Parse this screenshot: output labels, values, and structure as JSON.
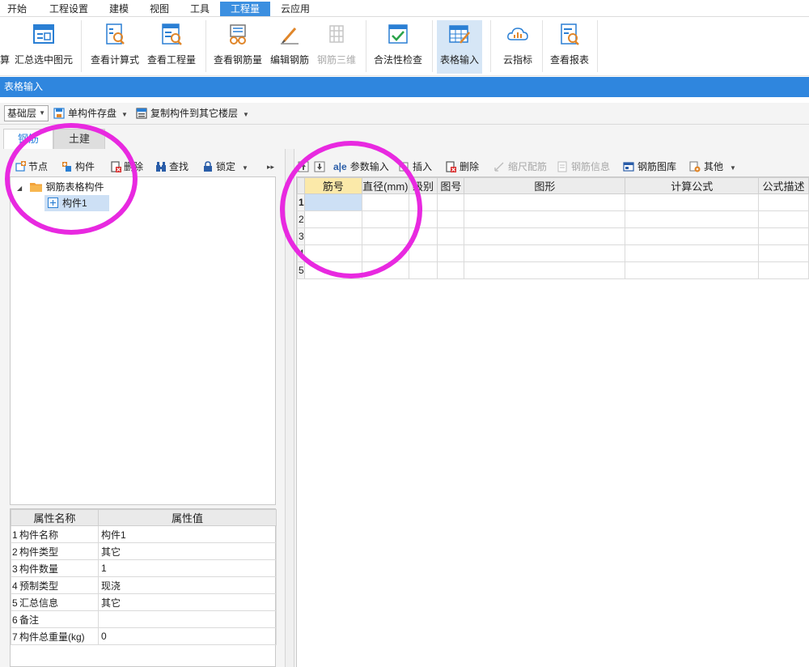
{
  "menu": {
    "items": [
      "开始",
      "工程设置",
      "建模",
      "视图",
      "工具",
      "工程量",
      "云应用"
    ],
    "active_index": 5
  },
  "ribbon": {
    "buttons": [
      {
        "label": "算",
        "icon": "calc-icon"
      },
      {
        "label": "汇总选中图元",
        "icon": "summary-selected-icon"
      },
      {
        "label": "查看计算式",
        "icon": "view-formula-icon"
      },
      {
        "label": "查看工程量",
        "icon": "view-quantity-icon"
      },
      {
        "label": "查看钢筋量",
        "icon": "view-rebar-icon"
      },
      {
        "label": "编辑钢筋",
        "icon": "edit-rebar-icon"
      },
      {
        "label": "钢筋三维",
        "icon": "rebar-3d-icon",
        "disabled": true
      },
      {
        "label": "合法性检查",
        "icon": "check-icon"
      },
      {
        "label": "表格输入",
        "icon": "table-input-icon",
        "selected": true
      },
      {
        "label": "云指标",
        "icon": "cloud-index-icon"
      },
      {
        "label": "查看报表",
        "icon": "view-report-icon"
      }
    ]
  },
  "title": "表格输入",
  "toolbar1": {
    "floor": "基础层",
    "save_component": "单构件存盘",
    "copy_to_floor": "复制构件到其它楼层"
  },
  "tabs": [
    "钢筋",
    "土建"
  ],
  "left_toolbar": {
    "node": "节点",
    "component": "构件",
    "delete": "删除",
    "find": "查找",
    "lock": "锁定"
  },
  "tree": {
    "root": "钢筋表格构件",
    "child": "构件1"
  },
  "properties": {
    "headers": [
      "属性名称",
      "属性值"
    ],
    "rows": [
      {
        "idx": "1",
        "name": "构件名称",
        "value": "构件1"
      },
      {
        "idx": "2",
        "name": "构件类型",
        "value": "其它"
      },
      {
        "idx": "3",
        "name": "构件数量",
        "value": "1"
      },
      {
        "idx": "4",
        "name": "预制类型",
        "value": "现浇"
      },
      {
        "idx": "5",
        "name": "汇总信息",
        "value": "其它"
      },
      {
        "idx": "6",
        "name": "备注",
        "value": ""
      },
      {
        "idx": "7",
        "name": "构件总重量(kg)",
        "value": "0"
      }
    ]
  },
  "right_toolbar": {
    "param_input": "参数输入",
    "insert": "插入",
    "delete": "删除",
    "scale_rebar": "缩尺配筋",
    "rebar_info": "钢筋信息",
    "rebar_library": "钢筋图库",
    "other": "其他"
  },
  "grid": {
    "headers": [
      "筋号",
      "直径(mm)",
      "级别",
      "图号",
      "图形",
      "计算公式",
      "公式描述"
    ],
    "rows": [
      "1",
      "2",
      "3",
      "4",
      "5"
    ]
  },
  "colors": {
    "accent": "#2f86de",
    "annotation": "#e829e0",
    "header_highlight": "#fbe9a9"
  }
}
